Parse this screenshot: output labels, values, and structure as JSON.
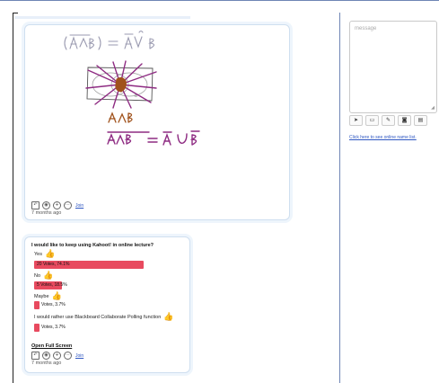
{
  "colors": {
    "vote_bar": "#e84a5f",
    "ink_purple": "#8e2b82",
    "ink_brown": "#a0521c",
    "ink_gray": "#9a9ab0",
    "link": "#2f57c2"
  },
  "whiteboard_post": {
    "join_label": "Join",
    "time_ago": "7 months ago",
    "icons": [
      "reply-icon",
      "eye-icon",
      "plus-icon",
      "more-icon",
      "people-icon"
    ]
  },
  "poll_post": {
    "question": "I would like to keep using Kahoot! in online lecture?",
    "options": [
      {
        "label": "Yes",
        "bar_text": "20 Votes, 74.1%",
        "share": 0.741
      },
      {
        "label": "No",
        "bar_text": "5 Votes, 18.5%",
        "share": 0.185
      },
      {
        "label": "Maybe",
        "bar_text": "Votes, 3.7%",
        "share": 0.037
      },
      {
        "label": "I would rather use Blackboard Collaborate Polling function",
        "bar_text": "Votes, 3.7%",
        "share": 0.037
      }
    ],
    "open_full_screen": "Open Full Screen",
    "join_label": "Join",
    "time_ago": "7 months ago"
  },
  "chat_panel": {
    "message_placeholder": "message",
    "tools": [
      "send-icon",
      "chat-icon",
      "pencil-icon",
      "camera-icon",
      "poll-icon"
    ],
    "online_link": "Click here to see online name list."
  }
}
